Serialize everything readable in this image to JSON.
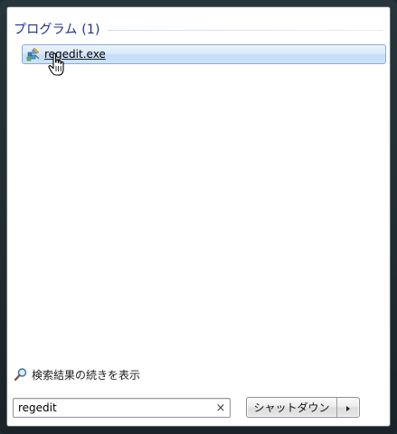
{
  "results": {
    "header": "プログラム (1)",
    "items": [
      {
        "label": "regedit.exe",
        "icon": "regedit-icon"
      }
    ]
  },
  "see_more": {
    "label": "検索結果の続きを表示",
    "icon": "magnifier-icon"
  },
  "search": {
    "value": "regedit",
    "clear_glyph": "×"
  },
  "shutdown": {
    "label": "シャットダウン",
    "options_icon": "triangle-right-icon"
  },
  "colors": {
    "frame": "#1c2a2f",
    "header_text": "#1e3287",
    "selection_border": "#84acdd",
    "selection_fill": "#dbeafc"
  }
}
